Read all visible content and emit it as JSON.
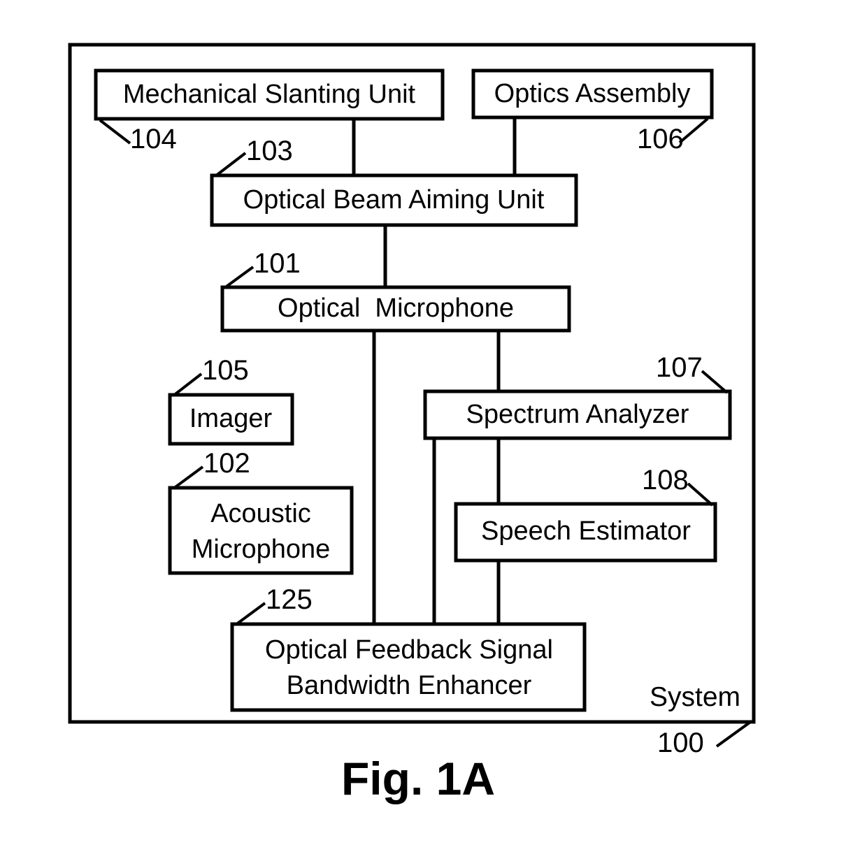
{
  "figure": {
    "caption": "Fig. 1A",
    "system_label": "System",
    "system_ref": "100"
  },
  "blocks": {
    "mechanical_slanting_unit": {
      "label": "Mechanical Slanting Unit",
      "ref": "104"
    },
    "optics_assembly": {
      "label": "Optics Assembly",
      "ref": "106"
    },
    "optical_beam_aiming_unit": {
      "label": "Optical Beam Aiming Unit",
      "ref": "103"
    },
    "optical_microphone": {
      "label": "Optical  Microphone",
      "ref": "101"
    },
    "imager": {
      "label": "Imager",
      "ref": "105"
    },
    "acoustic_microphone": {
      "label_line1": "Acoustic",
      "label_line2": "Microphone",
      "ref": "102"
    },
    "spectrum_analyzer": {
      "label": "Spectrum Analyzer",
      "ref": "107"
    },
    "speech_estimator": {
      "label": "Speech Estimator",
      "ref": "108"
    },
    "optical_feedback_signal_bandwidth_enhancer": {
      "label_line1": "Optical Feedback Signal",
      "label_line2": "Bandwidth Enhancer",
      "ref": "125"
    }
  },
  "colors": {
    "stroke": "#000000",
    "fill": "#ffffff",
    "background": "#ffffff"
  }
}
